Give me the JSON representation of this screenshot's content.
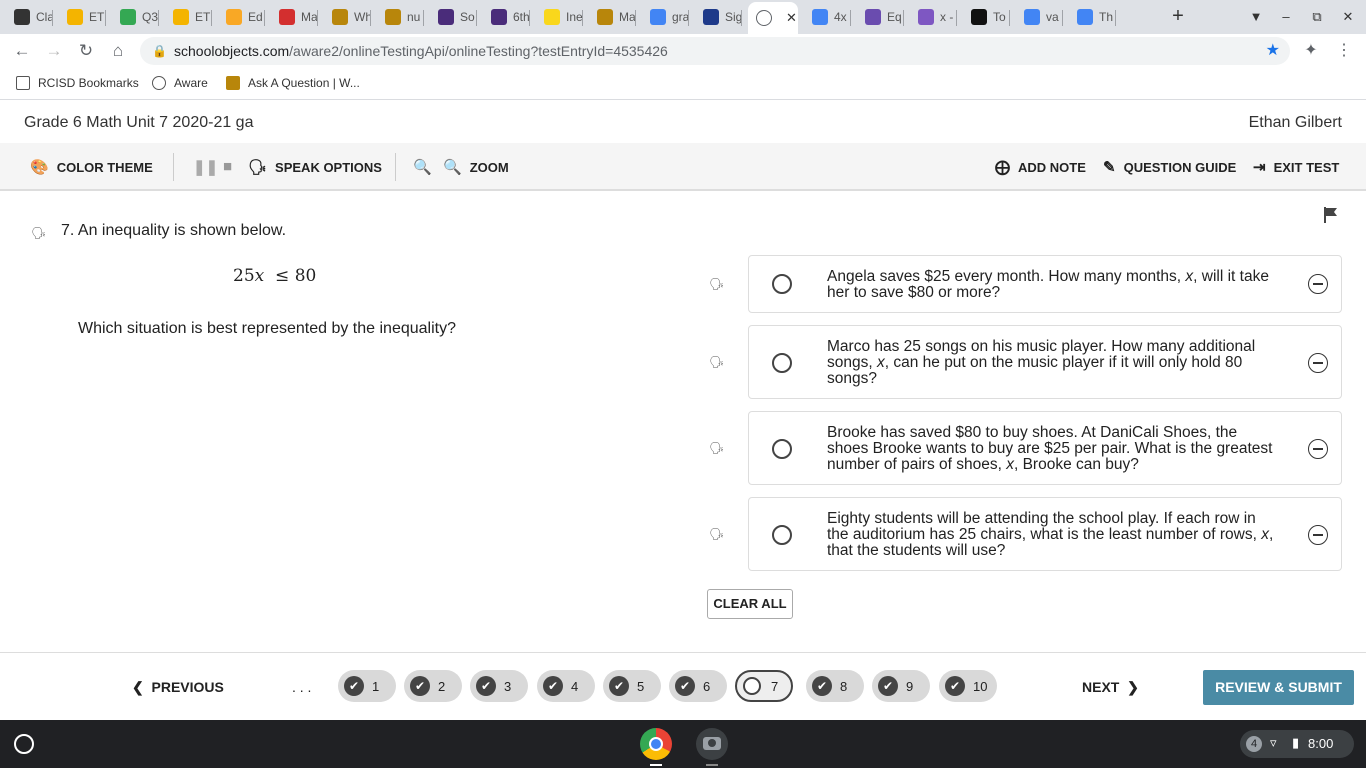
{
  "browser": {
    "tabs": [
      {
        "label": "Cla",
        "icon": "classroom-icon",
        "color": "#333333"
      },
      {
        "label": "ET",
        "icon": "slides-icon",
        "color": "#f4b400"
      },
      {
        "label": "Q3",
        "icon": "drive-icon",
        "color": "#34a853"
      },
      {
        "label": "ET",
        "icon": "slides-icon",
        "color": "#f4b400"
      },
      {
        "label": "Ed",
        "icon": "edpuzzle-icon",
        "color": "#f9a825"
      },
      {
        "label": "Ma",
        "icon": "mcgraw-icon",
        "color": "#d32f2f"
      },
      {
        "label": "Wh",
        "icon": "aware-icon",
        "color": "#b8860b"
      },
      {
        "label": "nu",
        "icon": "aware-icon",
        "color": "#b8860b"
      },
      {
        "label": "So",
        "icon": "quizlet-icon",
        "color": "#4a2c7a"
      },
      {
        "label": "6th",
        "icon": "quizlet-icon",
        "color": "#4a2c7a"
      },
      {
        "label": "Ine",
        "icon": "smiley-icon",
        "color": "#f9d71c"
      },
      {
        "label": "Ma",
        "icon": "aware-icon",
        "color": "#b8860b"
      },
      {
        "label": "gra",
        "icon": "google-icon",
        "color": "#4285f4"
      },
      {
        "label": "Sig",
        "icon": "stripes-icon",
        "color": "#1e3a8a"
      },
      {
        "label": "",
        "icon": "globe-icon",
        "color": "#5f6368",
        "active": true
      },
      {
        "label": "4x",
        "icon": "google-icon",
        "color": "#4285f4"
      },
      {
        "label": "Eq",
        "icon": "quill-icon",
        "color": "#6a4caf"
      },
      {
        "label": "x -",
        "icon": "ut-icon",
        "color": "#7e57c2"
      },
      {
        "label": "To",
        "icon": "b-icon",
        "color": "#111111"
      },
      {
        "label": "va",
        "icon": "google-icon",
        "color": "#4285f4"
      },
      {
        "label": "Th",
        "icon": "google-icon",
        "color": "#4285f4"
      }
    ],
    "url_host": "schoolobjects.com",
    "url_path": "/aware2/onlineTestingApi/onlineTesting?testEntryId=4535426",
    "bookmarks": [
      "RCISD Bookmarks",
      "Aware",
      "Ask A Question | W..."
    ]
  },
  "test": {
    "title": "Grade 6 Math Unit 7 2020-21 ga",
    "student": "Ethan Gilbert"
  },
  "tools": {
    "color_theme": "COLOR THEME",
    "speak_options": "SPEAK OPTIONS",
    "zoom": "ZOOM",
    "add_note": "ADD NOTE",
    "question_guide": "QUESTION GUIDE",
    "exit_test": "EXIT TEST"
  },
  "question": {
    "number_text": "7. An inequality is shown below.",
    "inequality_coef": "25",
    "inequality_var": "x",
    "inequality_rest": "≤ 80",
    "prompt": "Which situation is best represented by the inequality?",
    "choices": [
      {
        "parts": [
          "Angela saves $25 every month. How many months, ",
          "x",
          ", will it take her to save $80 or more?"
        ]
      },
      {
        "parts": [
          "Marco has 25 songs on his music player. How many additional songs, ",
          "x",
          ", can he put on the music player if it will only hold 80 songs?"
        ]
      },
      {
        "parts": [
          "Brooke has saved $80 to buy shoes. At DaniCali Shoes, the shoes Brooke wants to buy are $25 per pair. What is the greatest number of pairs of shoes, ",
          "x",
          ", Brooke can buy?"
        ]
      },
      {
        "parts": [
          "Eighty students will be attending the school play. If each row in the auditorium has 25 chairs, what is the least number of rows, ",
          "x",
          ", that the students will use?"
        ]
      }
    ],
    "clear_all": "CLEAR ALL"
  },
  "navigation": {
    "previous": "PREVIOUS",
    "ellipsis": ". . .",
    "next": "NEXT",
    "review_submit": "REVIEW & SUBMIT",
    "questions": [
      {
        "num": "1",
        "answered": true
      },
      {
        "num": "2",
        "answered": true
      },
      {
        "num": "3",
        "answered": true
      },
      {
        "num": "4",
        "answered": true
      },
      {
        "num": "5",
        "answered": true
      },
      {
        "num": "6",
        "answered": true
      },
      {
        "num": "7",
        "answered": false,
        "current": true
      },
      {
        "num": "8",
        "answered": true
      },
      {
        "num": "9",
        "answered": true
      },
      {
        "num": "10",
        "answered": true
      }
    ]
  },
  "system": {
    "notification_count": "4",
    "time": "8:00"
  },
  "colors": {
    "review_button": "#4a8ba5",
    "star": "#1a73e8"
  }
}
